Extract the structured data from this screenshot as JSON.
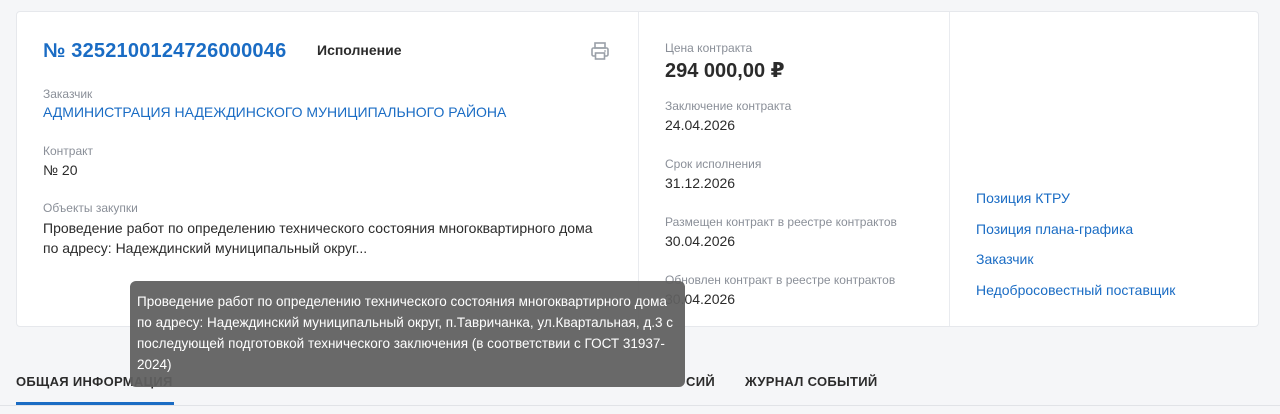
{
  "contract": {
    "number": "№ 3252100124726000046",
    "status": "Исполнение",
    "customer_label": "Заказчик",
    "customer_name": "АДМИНИСТРАЦИЯ НАДЕЖДИНСКОГО МУНИЦИПАЛЬНОГО РАЙОНА",
    "contract_label": "Контракт",
    "contract_value": "№ 20",
    "objects_label": "Объекты закупки",
    "objects_text": "Проведение работ по определению технического состояния многоквартирного дома по адресу: Надеждинский муниципальный округ..."
  },
  "details": {
    "price_label": "Цена контракта",
    "price_value": "294 000,00 ₽",
    "conclusion_label": "Заключение контракта",
    "conclusion_value": "24.04.2026",
    "term_label": "Срок исполнения",
    "term_value": "31.12.2026",
    "placed_label": "Размещен контракт в реестре контрактов",
    "placed_value": "30.04.2026",
    "updated_label": "Обновлен контракт в реестре контрактов",
    "updated_value": "30.04.2026"
  },
  "links": {
    "ktru": "Позиция КТРУ",
    "plan": "Позиция плана-графика",
    "customer": "Заказчик",
    "unfair_supplier": "Недобросовестный поставщик"
  },
  "tooltip": {
    "text": "Проведение работ по определению технического состояния многоквартирного дома по адресу: Надеждинский муниципальный округ, п.Тавричанка, ул.Квартальная, д.3 с последующей подготовкой технического заключения (в соответствии с ГОСТ 31937-2024)"
  },
  "tabs": {
    "general": "ОБЩАЯ ИНФОРМАЦИЯ",
    "versions_partial": "СИЙ",
    "events": "ЖУРНАЛ СОБЫТИЙ"
  },
  "icons": {
    "print": "printer-icon"
  },
  "colors": {
    "accent": "#1a6cc4",
    "tooltip_bg": "#606060"
  }
}
